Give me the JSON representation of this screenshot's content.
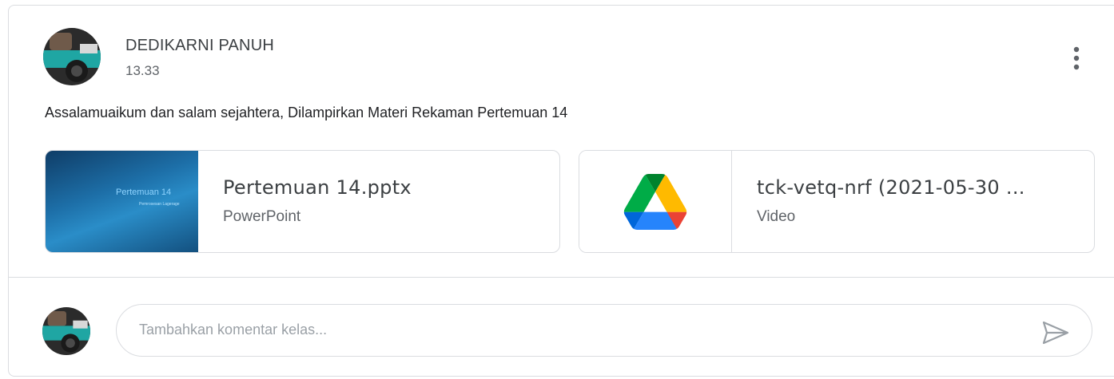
{
  "post": {
    "author": "DEDIKARNI PANUH",
    "time": "13.33",
    "text": "Assalamuaikum dan salam sejahtera, Dilampirkan Materi Rekaman Pertemuan 14"
  },
  "attachments": [
    {
      "title": "Pertemuan 14.pptx",
      "type": "PowerPoint",
      "thumbnail_title": "Pertemuan 14",
      "thumbnail_subtitle": "Pemrosesan Lagerage"
    },
    {
      "title": "tck-vetq-nrf (2021-05-30 ...",
      "type": "Video",
      "icon": "google-drive-icon"
    }
  ],
  "comment": {
    "placeholder": "Tambahkan komentar kelas..."
  },
  "icons": {
    "menu": "more-vert-icon",
    "send": "send-icon"
  },
  "colors": {
    "border": "#dadce0",
    "text_primary": "#3c4043",
    "text_secondary": "#5f6368",
    "placeholder": "#9aa0a6"
  }
}
